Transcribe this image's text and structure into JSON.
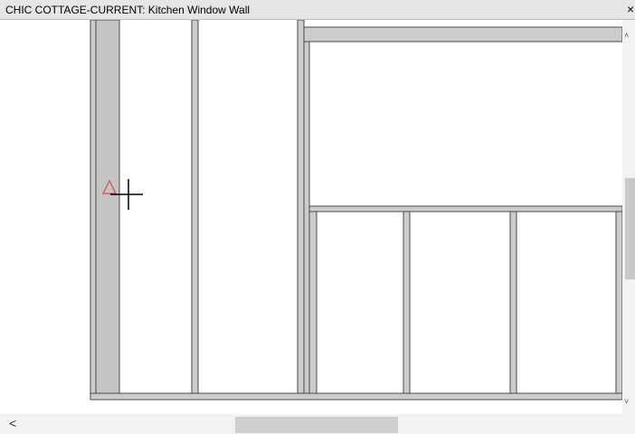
{
  "window": {
    "title": "CHIC COTTAGE-CURRENT: Kitchen Window Wall",
    "close_glyph": "×"
  },
  "scrollbars": {
    "up_arrow": "˄",
    "down_arrow": "˅",
    "left_arrow": "<"
  },
  "drawing": {
    "background": "#ffffff",
    "framing_fill": "#cccccc",
    "stroke": "#4a4a4a",
    "marker_color": "#e04848"
  }
}
